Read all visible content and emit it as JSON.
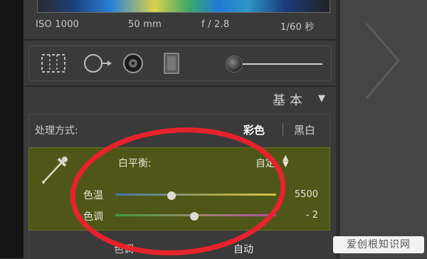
{
  "exif": {
    "iso": "ISO 1000",
    "focal": "50 mm",
    "aperture": "f / 2.8",
    "shutter": "1/60 秒"
  },
  "tools": [
    "crop-icon",
    "spot-removal-icon",
    "red-eye-icon",
    "graduated-filter-icon",
    "adjustment-brush-icon"
  ],
  "section": {
    "title": "基本",
    "arrow": "▼"
  },
  "treatment": {
    "label": "处理方式:",
    "color": "彩色",
    "bw": "黑白"
  },
  "white_balance": {
    "label": "白平衡:",
    "value": "自定",
    "arrows_up": "▲",
    "arrows_down": "▼",
    "temp": {
      "label": "色温",
      "value": "5500",
      "fraction": 0.35
    },
    "tint": {
      "label": "色调",
      "value": "- 2",
      "fraction": 0.49
    }
  },
  "tone": {
    "label": "色调",
    "auto": "自动"
  },
  "watermark": "爱创根知识网",
  "colors": {
    "panel": "#3a3a3a",
    "wb_highlight": "#4e5717",
    "annotation": "#e8222a"
  }
}
